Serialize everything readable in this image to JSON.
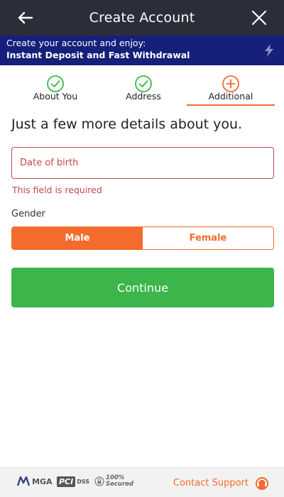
{
  "header": {
    "title": "Create Account"
  },
  "banner": {
    "line1": "Create your account and enjoy:",
    "line2": "Instant Deposit and Fast Withdrawal"
  },
  "steps": [
    {
      "label": "About You",
      "status": "done"
    },
    {
      "label": "Address",
      "status": "done"
    },
    {
      "label": "Additional",
      "status": "active"
    }
  ],
  "form": {
    "heading": "Just a few more details about you.",
    "dob_placeholder": "Date of birth",
    "dob_error": "This field is required",
    "gender_label": "Gender",
    "gender_options": [
      "Male",
      "Female"
    ],
    "gender_selected": "Male",
    "continue_label": "Continue"
  },
  "footer": {
    "mga": "MGA",
    "pci": "PCI",
    "dss": "DSS",
    "secured_pct": "100%",
    "secured_label": "Secured",
    "support_label": "Contact Support"
  },
  "colors": {
    "header": "#2b2e39",
    "banner": "#16207a",
    "accent": "#f46b2e",
    "success": "#3cb54a",
    "error": "#c5484a"
  }
}
